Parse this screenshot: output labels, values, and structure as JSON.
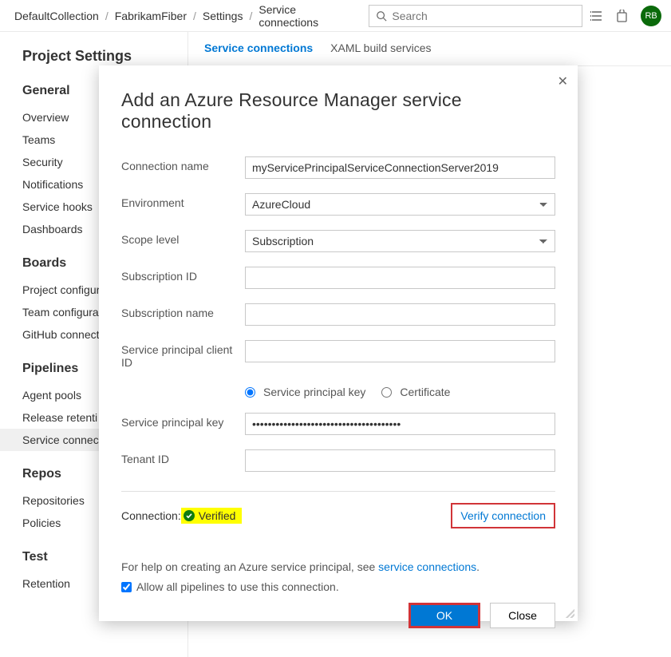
{
  "breadcrumbs": {
    "a": "DefaultCollection",
    "b": "FabrikamFiber",
    "c": "Settings",
    "d": "Service connections"
  },
  "search": {
    "placeholder": "Search"
  },
  "avatar": "RB",
  "sidebar": {
    "title": "Project Settings",
    "sections": {
      "general": {
        "label": "General",
        "items": [
          "Overview",
          "Teams",
          "Security",
          "Notifications",
          "Service hooks",
          "Dashboards"
        ]
      },
      "boards": {
        "label": "Boards",
        "items": [
          "Project configur",
          "Team configurat",
          "GitHub connect"
        ]
      },
      "pipelines": {
        "label": "Pipelines",
        "items": [
          "Agent pools",
          "Release retenti",
          "Service connec"
        ]
      },
      "repos": {
        "label": "Repos",
        "items": [
          "Repositories",
          "Policies"
        ]
      },
      "test": {
        "label": "Test",
        "items": [
          "Retention"
        ]
      }
    }
  },
  "tabs": {
    "sc": "Service connections",
    "xaml": "XAML build services"
  },
  "dialog": {
    "title": "Add an Azure Resource Manager service connection",
    "labels": {
      "conn_name": "Connection name",
      "env": "Environment",
      "scope": "Scope level",
      "sub_id": "Subscription ID",
      "sub_name": "Subscription name",
      "spc_id": "Service principal client ID",
      "sp_key": "Service principal key",
      "tenant": "Tenant ID"
    },
    "values": {
      "conn_name": "myServicePrincipalServiceConnectionServer2019",
      "env": "AzureCloud",
      "scope": "Subscription",
      "sub_id": "",
      "sub_name": "",
      "spc_id": "",
      "sp_key": "••••••••••••••••••••••••••••••••••••••",
      "tenant": ""
    },
    "radio": {
      "key": "Service principal key",
      "cert": "Certificate"
    },
    "conn_label": "Connection:",
    "verified": "Verified",
    "verify_link": "Verify connection",
    "help_pre": "For help on creating an Azure service principal, see ",
    "help_link": "service connections",
    "allow": "Allow all pipelines to use this connection.",
    "ok": "OK",
    "close": "Close"
  }
}
